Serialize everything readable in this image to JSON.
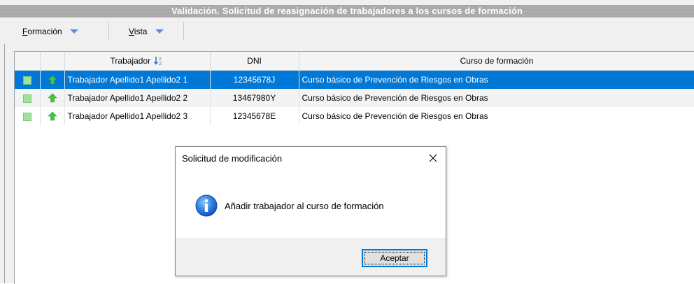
{
  "window": {
    "title": "Validación. Solicitud de reasignación de trabajadores a los cursos de formación"
  },
  "menu": {
    "items": [
      {
        "label": "Formación",
        "accel": "F",
        "rest": "ormación"
      },
      {
        "label": "Vista",
        "accel": "V",
        "rest": "ista"
      }
    ]
  },
  "grid": {
    "columns": [
      "",
      "",
      "Trabajador",
      "DNI",
      "Curso de formación"
    ],
    "sort_icon": "sort-ascending-icon",
    "rows": [
      {
        "trabajador": "Trabajador Apellido1 Apellido2 1",
        "dni": "12345678J",
        "curso": "Curso básico de Prevención de Riesgos en Obras",
        "selected": true
      },
      {
        "trabajador": "Trabajador Apellido1 Apellido2 2",
        "dni": "13467980Y",
        "curso": "Curso básico de Prevención de Riesgos en Obras",
        "selected": false
      },
      {
        "trabajador": "Trabajador Apellido1 Apellido2 3",
        "dni": "12345678E",
        "curso": "Curso básico de Prevención de Riesgos en Obras",
        "selected": false
      }
    ],
    "row_icons": [
      "green-square-icon",
      "green-up-arrow-icon"
    ]
  },
  "dialog": {
    "title": "Solicitud de modificación",
    "message": "Añadir trabajador al curso de formación",
    "button": "Aceptar",
    "icon": "info-icon"
  },
  "colors": {
    "selection": "#0078d7",
    "titlebar": "#a7a7a7",
    "menu_arrow": "#5a8fe0",
    "status_green": "#9fe39a"
  }
}
